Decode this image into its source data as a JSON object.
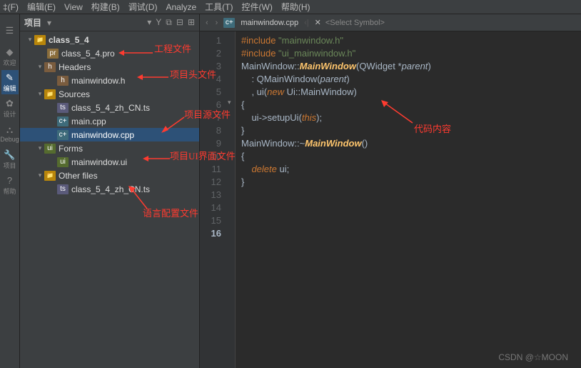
{
  "menubar": [
    "‡(F)",
    "编辑(E)",
    "View",
    "构建(B)",
    "调试(D)",
    "Analyze",
    "工具(T)",
    "控件(W)",
    "帮助(H)"
  ],
  "activity": [
    {
      "icon": "☰",
      "label": ""
    },
    {
      "icon": "◆",
      "label": "欢迎"
    },
    {
      "icon": "✎",
      "label": "编辑"
    },
    {
      "icon": "✿",
      "label": "设计"
    },
    {
      "icon": "⛬",
      "label": "Debug"
    },
    {
      "icon": "🔧",
      "label": "项目"
    },
    {
      "icon": "?",
      "label": "帮助"
    }
  ],
  "sidebar": {
    "title": "项目",
    "selector": "▾",
    "tools": [
      "▾",
      "Y",
      "⧉",
      "⊟",
      "⊞"
    ]
  },
  "tree": {
    "root": "class_5_4",
    "pro": "class_5_4.pro",
    "headers": "Headers",
    "headers_items": [
      "mainwindow.h"
    ],
    "sources": "Sources",
    "sources_items": [
      "class_5_4_zh_CN.ts",
      "main.cpp",
      "mainwindow.cpp"
    ],
    "forms": "Forms",
    "forms_items": [
      "mainwindow.ui"
    ],
    "other": "Other files",
    "other_items": [
      "class_5_4_zh_CN.ts"
    ]
  },
  "editor": {
    "tab_icon": "cpp",
    "tab": "mainwindow.cpp",
    "close": "✕",
    "symbol": "<Select Symbol>"
  },
  "code": {
    "lines": [
      {
        "n": 1,
        "t": [
          [
            "pp",
            "#include "
          ],
          [
            "str",
            "\"mainwindow.h\""
          ]
        ]
      },
      {
        "n": 2,
        "t": [
          [
            "pp",
            "#include "
          ],
          [
            "str",
            "\"ui_mainwindow.h\""
          ]
        ]
      },
      {
        "n": 3,
        "t": [
          [
            "",
            ""
          ]
        ]
      },
      {
        "n": 4,
        "t": [
          [
            "cls",
            "MainWindow"
          ],
          [
            "",
            "::"
          ],
          [
            "fn",
            "MainWindow"
          ],
          [
            "",
            "(QWidget *"
          ],
          [
            "param",
            "parent"
          ],
          [
            "",
            ")"
          ]
        ]
      },
      {
        "n": 5,
        "t": [
          [
            "",
            "    : "
          ],
          [
            "cls",
            "QMainWindow"
          ],
          [
            "",
            "("
          ],
          [
            "param",
            "parent"
          ],
          [
            "",
            ")"
          ]
        ]
      },
      {
        "n": 6,
        "t": [
          [
            "",
            "    , ui("
          ],
          [
            "kw",
            "new"
          ],
          [
            "",
            ""
          ],
          [
            "",
            ""
          ],
          [
            "",
            ""
          ],
          [
            "",
            ""
          ],
          [
            "",
            ""
          ],
          [
            "",
            ""
          ],
          [
            "",
            ""
          ],
          [
            "",
            ""
          ],
          [
            "",
            ""
          ],
          [
            "",
            ""
          ],
          [
            "",
            " Ui::"
          ],
          [
            "cls",
            "MainWindow"
          ],
          [
            "",
            ")"
          ]
        ]
      },
      {
        "n": 7,
        "t": [
          [
            "",
            "{"
          ]
        ]
      },
      {
        "n": 8,
        "t": [
          [
            "",
            "    ui->setupUi("
          ],
          [
            "this",
            "this"
          ],
          [
            "",
            ");"
          ]
        ]
      },
      {
        "n": 9,
        "t": [
          [
            "",
            "}"
          ]
        ]
      },
      {
        "n": 10,
        "t": [
          [
            "",
            ""
          ]
        ]
      },
      {
        "n": 11,
        "t": [
          [
            "cls",
            "MainWindow"
          ],
          [
            "",
            "::~"
          ],
          [
            "fn",
            "MainWindow"
          ],
          [
            "",
            "()"
          ]
        ]
      },
      {
        "n": 12,
        "t": [
          [
            "",
            "{"
          ]
        ]
      },
      {
        "n": 13,
        "t": [
          [
            "",
            "    "
          ],
          [
            "kw",
            "delete"
          ],
          [
            "",
            ""
          ],
          [
            "",
            ""
          ],
          [
            "",
            ""
          ],
          [
            "",
            ""
          ],
          [
            "",
            ""
          ],
          [
            "",
            ""
          ],
          [
            "",
            ""
          ],
          [
            "",
            ""
          ],
          [
            "",
            ""
          ],
          [
            "",
            ""
          ],
          [
            "",
            " ui;"
          ]
        ]
      },
      {
        "n": 14,
        "t": [
          [
            "",
            "}"
          ]
        ]
      },
      {
        "n": 15,
        "t": [
          [
            "",
            ""
          ]
        ]
      },
      {
        "n": 16,
        "t": [
          [
            "",
            ""
          ]
        ]
      }
    ],
    "current_line": 16
  },
  "annotations": {
    "a1": "工程文件",
    "a2": "项目头文件",
    "a3": "项目源文件",
    "a4": "项目UI界面文件",
    "a5": "代码内容",
    "a6": "语言配置文件"
  },
  "watermark": "CSDN @☆MOON"
}
